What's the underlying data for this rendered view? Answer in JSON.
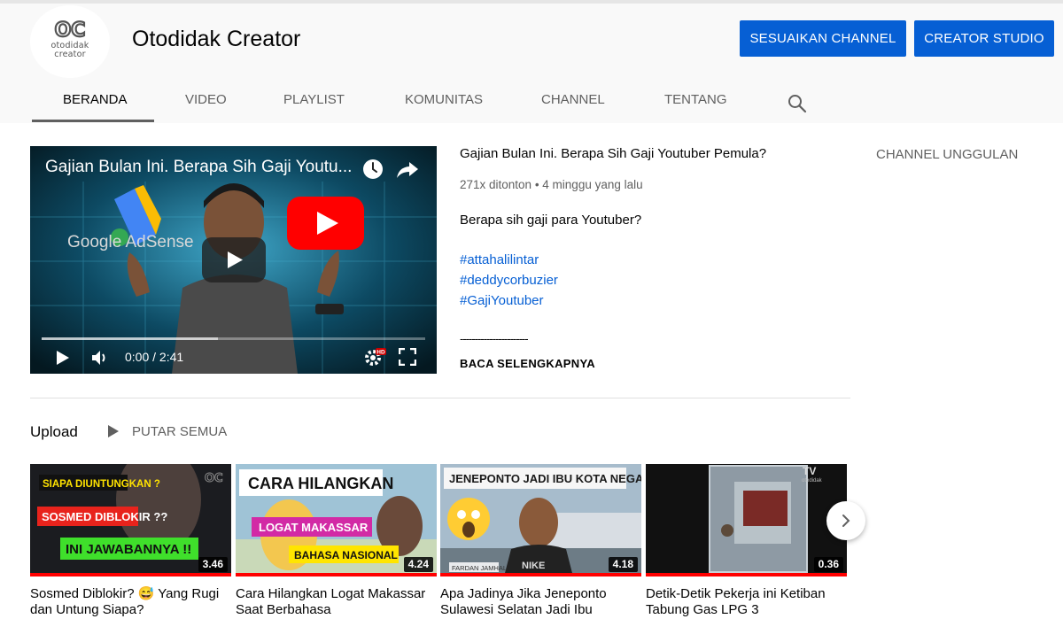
{
  "channel": {
    "name": "Otodidak Creator",
    "logo_mark": "OC",
    "logo_line1": "otodidak",
    "logo_line2": "creator"
  },
  "header_buttons": {
    "customize": "SESUAIKAN CHANNEL",
    "studio": "CREATOR STUDIO"
  },
  "tabs": [
    {
      "label": "BERANDA",
      "active": true
    },
    {
      "label": "VIDEO",
      "active": false
    },
    {
      "label": "PLAYLIST",
      "active": false
    },
    {
      "label": "KOMUNITAS",
      "active": false
    },
    {
      "label": "CHANNEL",
      "active": false
    },
    {
      "label": "TENTANG",
      "active": false
    }
  ],
  "player": {
    "overlay_title": "Gajian Bulan Ini. Berapa Sih Gaji Youtu...",
    "brand_text": "Google AdSense",
    "time": "0:00 / 2:41",
    "progress_fraction": 0,
    "buffered_fraction": 0.46
  },
  "featured_video": {
    "title": "Gajian Bulan Ini. Berapa Sih Gaji Youtuber Pemula?",
    "meta": "271x ditonton • 4 minggu yang lalu",
    "description": "Berapa sih gaji para Youtuber?",
    "hashtags": [
      "#attahalilintar",
      "#deddycorbuzier",
      "#GajiYoutuber"
    ],
    "separator": "-----------------------",
    "read_more": "BACA SELENGKAPNYA"
  },
  "sidebar": {
    "featured_channels": "CHANNEL UNGGULAN"
  },
  "upload_section": {
    "label": "Upload",
    "play_all": "PUTAR SEMUA",
    "videos": [
      {
        "title": "Sosmed Diblokir? 😅 Yang Rugi dan Untung Siapa?",
        "duration": "3.46",
        "thumb_texts": [
          "SIAPA DIUNTUNGKAN ?",
          "SOSMED DIBLOKIR ??",
          "INI JAWABANNYA !!"
        ],
        "thumb_logo": "OC"
      },
      {
        "title": "Cara Hilangkan Logat Makassar Saat Berbahasa",
        "duration": "4.24",
        "thumb_texts": [
          "CARA HILANGKAN",
          "LOGAT MAKASSAR",
          "BAHASA NASIONAL"
        ]
      },
      {
        "title": "Apa Jadinya Jika Jeneponto Sulawesi Selatan Jadi Ibu",
        "duration": "4.18",
        "thumb_texts": [
          "JENEPONTO JADI IBU KOTA NEGARA",
          "FARDAN JAMHAL",
          "NIKE"
        ]
      },
      {
        "title": "Detik-Detik Pekerja ini Ketiban Tabung Gas LPG 3",
        "duration": "0.36",
        "thumb_texts": [
          "TV",
          "otodidak"
        ]
      }
    ]
  },
  "icons": {
    "search": "search-icon",
    "clock": "clock-icon",
    "share": "share-icon",
    "next": "chevron-right-icon"
  },
  "colors": {
    "brand_blue": "#065fd4",
    "youtube_red": "#ff0000",
    "header_bg": "#f9f9f9"
  }
}
